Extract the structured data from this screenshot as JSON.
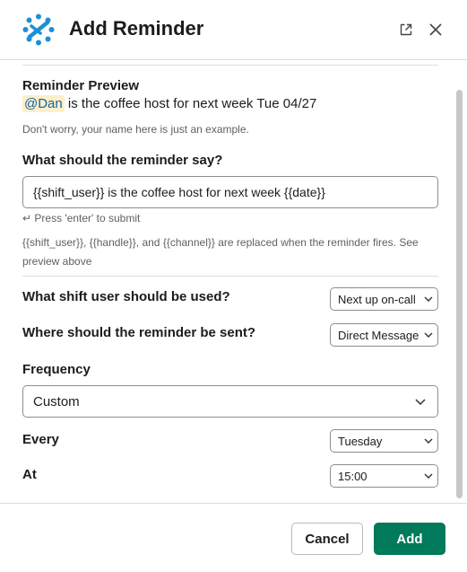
{
  "modal": {
    "title": "Add Reminder",
    "popout_icon": "external-link-icon",
    "close_icon": "close-icon",
    "logo_icon": "app-logo"
  },
  "preview": {
    "heading": "Reminder Preview",
    "mention": "@Dan",
    "text": " is the coffee host for next week Tue 04/27",
    "note": "Don't worry, your name here is just an example."
  },
  "message": {
    "label": "What should the reminder say?",
    "value": "{{shift_user}} is the coffee host for next week {{date}}",
    "hint": "↵ Press 'enter' to submit",
    "help": "{{shift_user}}, {{handle}}, and {{channel}} are replaced when the reminder fires. See preview above"
  },
  "shift_user": {
    "label": "What shift user should be used?",
    "value": "Next up on-call"
  },
  "destination": {
    "label": "Where should the reminder be sent?",
    "value": "Direct Message"
  },
  "frequency": {
    "label": "Frequency",
    "value": "Custom"
  },
  "every": {
    "label": "Every",
    "value": "Tuesday"
  },
  "at": {
    "label": "At",
    "value": "15:00"
  },
  "footer": {
    "cancel_label": "Cancel",
    "add_label": "Add"
  },
  "colors": {
    "primary": "#007a5a",
    "mention_bg": "#fcefc9",
    "mention_text": "#1264a3",
    "logo": "#1a8fd6"
  }
}
